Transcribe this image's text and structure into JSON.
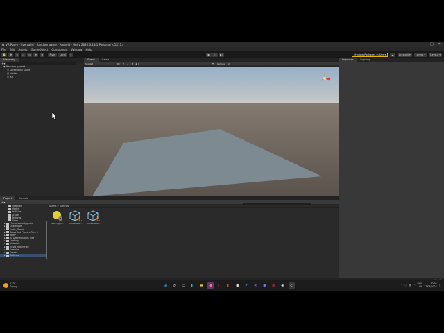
{
  "window": {
    "title": "VR Room - live calisi - Random game - Android - Unity 2020.3.14f1 Personal <DX11>",
    "controls": [
      "—",
      "□",
      "✕"
    ]
  },
  "menu": [
    "File",
    "Edit",
    "Assets",
    "GameObject",
    "Component",
    "Window",
    "Help"
  ],
  "toolbar": {
    "pivot_label": "Pivot",
    "local_label": "Local",
    "preview_label": "Preview Packages in Use ▾",
    "account_label": "Account ▾",
    "layers_label": "Layers ▾",
    "layout_label": "Layout ▾"
  },
  "hierarchy": {
    "tabs": [
      "Hierarchy"
    ],
    "rows": [
      {
        "label": "Random game*",
        "indent": 1,
        "icon": "unity-scene-icon"
      },
      {
        "label": "Directional Light",
        "indent": 2,
        "icon": "gameobject-icon"
      },
      {
        "label": "Water",
        "indent": 2,
        "icon": "gameobject-icon"
      },
      {
        "label": "XR",
        "indent": 2,
        "icon": "gameobject-icon"
      }
    ]
  },
  "scene": {
    "tabs": [
      "Scene",
      "Game"
    ],
    "shading_mode": "Shaded",
    "mode_2d": "2D",
    "gizmos_label": "Gizmos",
    "search_label": "All"
  },
  "inspector": {
    "tabs": [
      "Inspector",
      "Lighting"
    ]
  },
  "project": {
    "tabs": [
      "Project",
      "Console"
    ],
    "breadcrumb": "Assets > Settings",
    "tree": [
      {
        "label": "Materials",
        "indent": 3
      },
      {
        "label": "Models",
        "indent": 3
      },
      {
        "label": "Particles",
        "indent": 3
      },
      {
        "label": "Scripts",
        "indent": 3
      },
      {
        "label": "Textures",
        "indent": 3
      },
      {
        "label": "Video",
        "indent": 3
      },
      {
        "label": "_TerrainAutoUpgrade",
        "indent": 2
      },
      {
        "label": "Challenges",
        "indent": 2
      },
      {
        "label": "Earth_Atmos",
        "indent": 2
      },
      {
        "label": "Grass And Flowers Pack 1",
        "indent": 2
      },
      {
        "label": "HDRP",
        "indent": 2
      },
      {
        "label": "JD_DefinedBlocks_Lite",
        "indent": 2
      },
      {
        "label": "LowPoly",
        "indent": 2
      },
      {
        "label": "Materials",
        "indent": 2
      },
      {
        "label": "Meow Maker Free",
        "indent": 2
      },
      {
        "label": "Samples",
        "indent": 2
      },
      {
        "label": "Scenes",
        "indent": 2
      },
      {
        "label": "Settings",
        "indent": 2
      }
    ],
    "assets": [
      {
        "label": "New Light...",
        "icon": "lightbulb-gear-icon"
      },
      {
        "label": "UniversalR...",
        "icon": "render-pipeline-asset-icon"
      },
      {
        "label": "UniversalR...",
        "icon": "render-pipeline-asset-icon"
      }
    ]
  },
  "taskbar": {
    "weather_temp": "23°C",
    "weather_desc": "Sunny",
    "lang": "ENG",
    "lang_sub": "UK",
    "time": "10:35",
    "date": "17/08/2024"
  },
  "colors": {
    "accent": "#e6b400",
    "sky_top": "#98b0c8",
    "ground": "#6a625a",
    "plane": "#7d8a92"
  }
}
